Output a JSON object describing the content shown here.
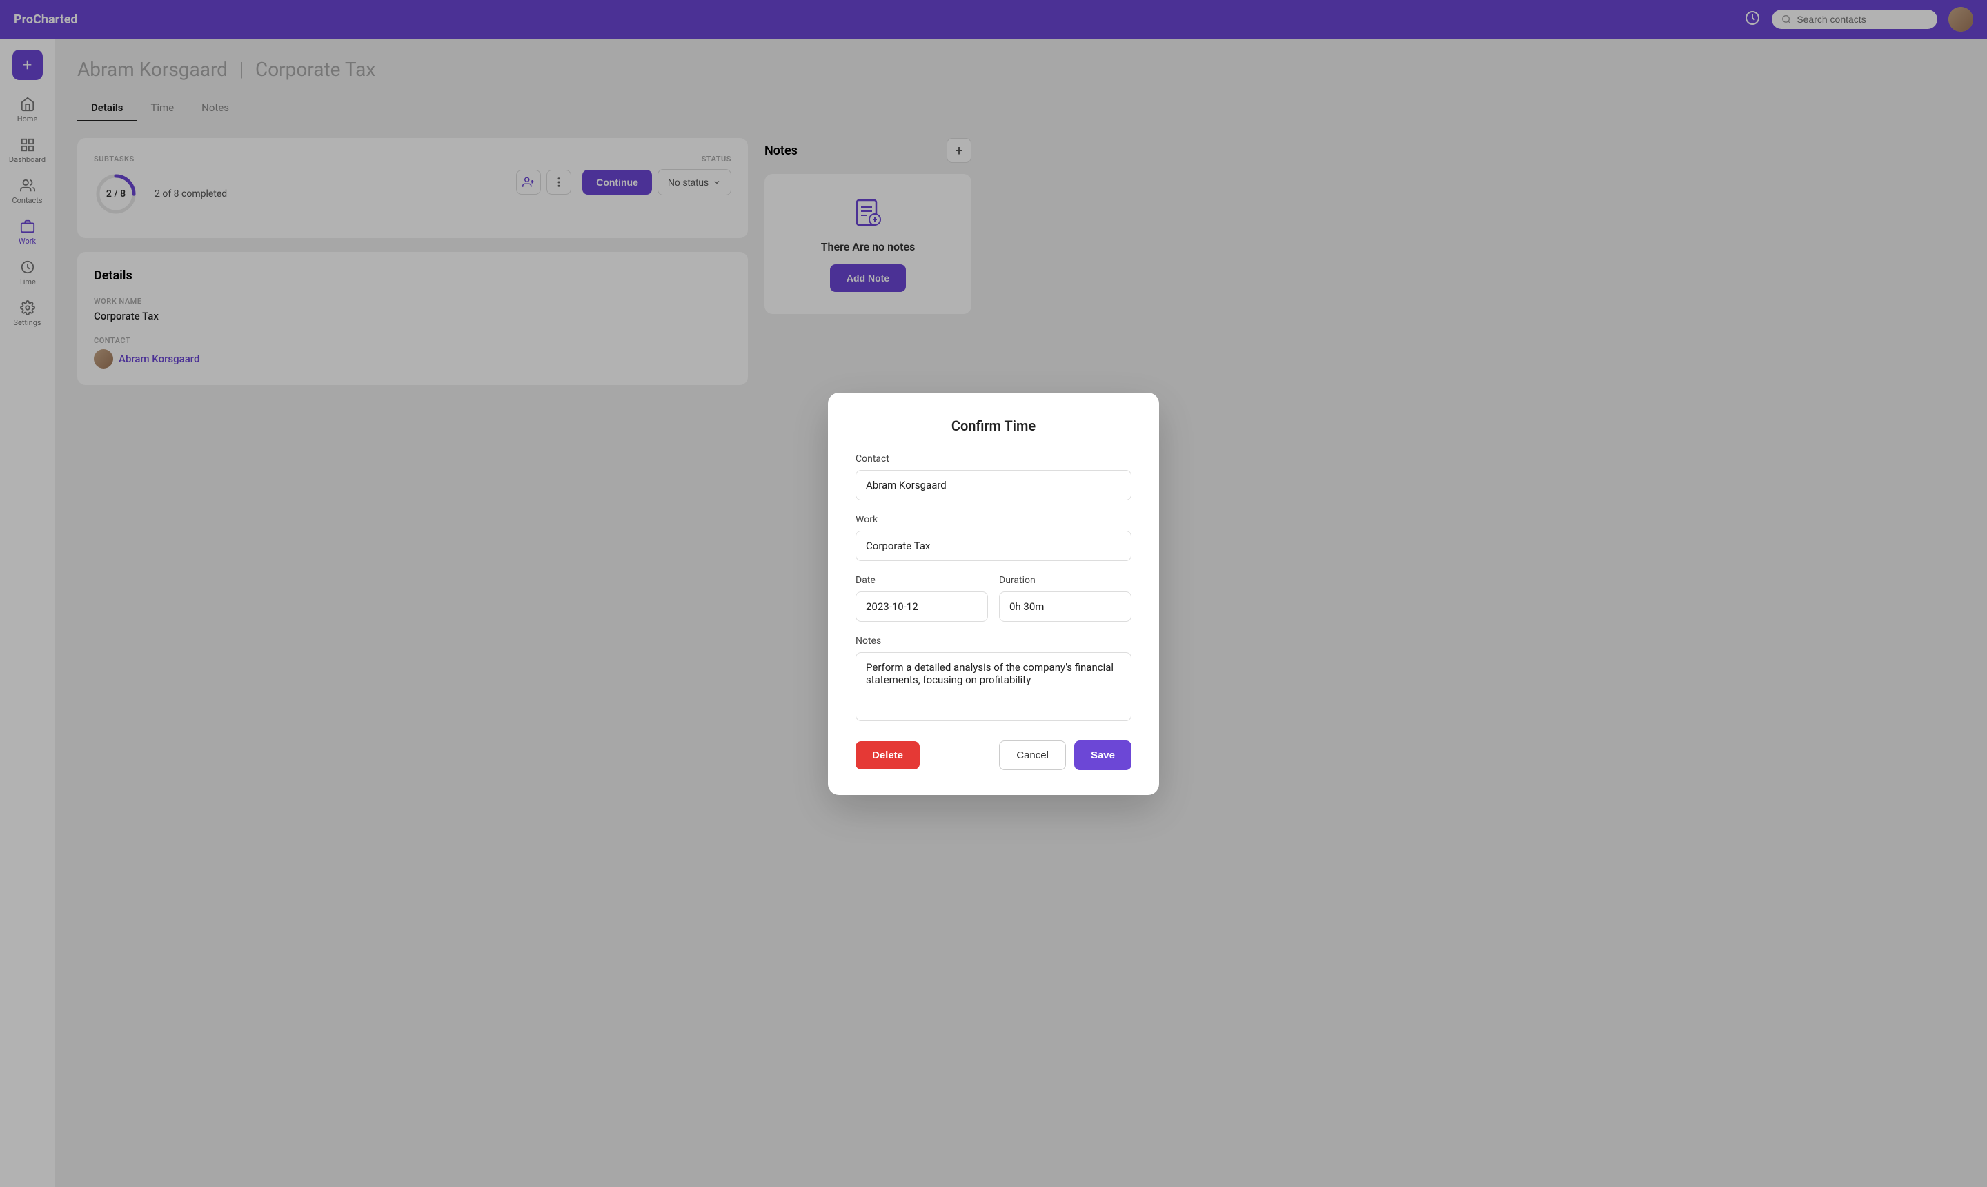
{
  "app": {
    "name": "ProCharted"
  },
  "topnav": {
    "search_placeholder": "Search contacts"
  },
  "sidebar": {
    "add_label": "+",
    "items": [
      {
        "id": "home",
        "label": "Home"
      },
      {
        "id": "dashboard",
        "label": "Dashboard"
      },
      {
        "id": "contacts",
        "label": "Contacts"
      },
      {
        "id": "work",
        "label": "Work",
        "active": true
      },
      {
        "id": "time",
        "label": "Time"
      },
      {
        "id": "settings",
        "label": "Settings"
      }
    ]
  },
  "page": {
    "contact_name": "Abram Korsgaard",
    "work_name": "Corporate Tax",
    "separator": "|"
  },
  "tabs": [
    {
      "id": "details",
      "label": "Details",
      "active": true
    },
    {
      "id": "time",
      "label": "Time"
    },
    {
      "id": "notes",
      "label": "Notes"
    }
  ],
  "subtasks": {
    "section_label": "SUBTASKS",
    "current": 2,
    "total": 8,
    "progress_text": "2 / 8",
    "completed_text": "2 of 8 completed"
  },
  "status": {
    "section_label": "STATUS",
    "continue_label": "Continue",
    "no_status_label": "No status"
  },
  "details_section": {
    "title": "Details",
    "work_name_label": "WORK NAME",
    "work_name_value": "Corporate Tax",
    "contact_label": "CONTACT",
    "contact_name": "Abram Korsgaard"
  },
  "notes_section": {
    "title": "Notes",
    "empty_text": "There Are no notes",
    "add_note_label": "Add Note"
  },
  "modal": {
    "title": "Confirm Time",
    "contact_label": "Contact",
    "contact_value": "Abram Korsgaard",
    "work_label": "Work",
    "work_value": "Corporate Tax",
    "date_label": "Date",
    "date_value": "2023-10-12",
    "duration_label": "Duration",
    "duration_value": "0h 30m",
    "notes_label": "Notes",
    "notes_value": "Perform a detailed analysis of the company's financial statements, focusing on profitability",
    "delete_label": "Delete",
    "cancel_label": "Cancel",
    "save_label": "Save"
  },
  "colors": {
    "brand": "#6c47d6",
    "delete": "#e53935"
  }
}
